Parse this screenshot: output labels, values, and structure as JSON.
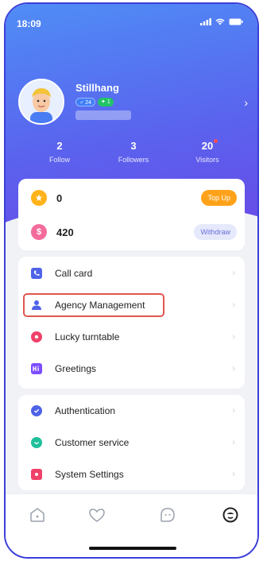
{
  "status": {
    "time": "18:09"
  },
  "profile": {
    "username": "Stillhang",
    "level_badge": "24",
    "vip_badge": "1"
  },
  "stats": [
    {
      "value": "2",
      "label": "Follow"
    },
    {
      "value": "3",
      "label": "Followers"
    },
    {
      "value": "20",
      "label": "Visitors"
    }
  ],
  "wallet": {
    "coins": {
      "value": "0",
      "button": "Top Up"
    },
    "diamonds": {
      "value": "420",
      "button": "Withdraw"
    }
  },
  "menu_primary": [
    {
      "label": "Call card",
      "icon": "call-card-icon",
      "color": "#4f63e8"
    },
    {
      "label": "Agency Management",
      "icon": "agency-icon",
      "color": "#4f63e8"
    },
    {
      "label": "Lucky turntable",
      "icon": "turntable-icon",
      "color": "#f0416a"
    },
    {
      "label": "Greetings",
      "icon": "greetings-icon",
      "color": "#7c4dff"
    }
  ],
  "menu_secondary": [
    {
      "label": "Authentication",
      "icon": "authentication-icon",
      "color": "#4f63e8"
    },
    {
      "label": "Customer service",
      "icon": "customer-service-icon",
      "color": "#1fbf9b"
    },
    {
      "label": "System Settings",
      "icon": "settings-icon",
      "color": "#f0416a"
    }
  ],
  "colors": {
    "accent": "#5a63ee",
    "highlight_border": "#e0564f",
    "topup": "#ffa21a"
  }
}
